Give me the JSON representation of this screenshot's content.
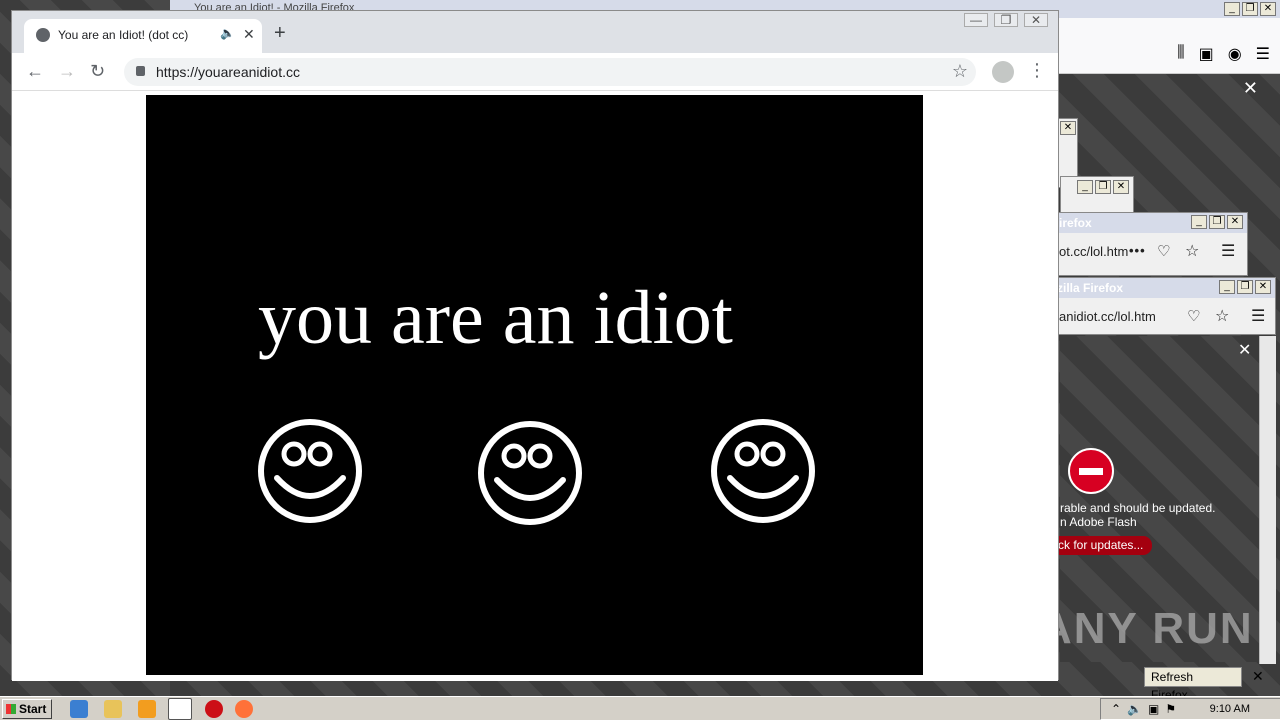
{
  "background_firefox": {
    "title_fragment": "You are an Idiot! - Mozilla Firefox",
    "popup1": {
      "title": "irefox",
      "url": "ot.cc/lol.htm"
    },
    "popup2": {
      "title": "zilla Firefox",
      "url": "anidiot.cc/lol.htm"
    },
    "flash_message_line1": "rable and should be updated.",
    "flash_message_line2": "n Adobe Flash",
    "flash_button": "ck for updates...",
    "refresh_button": "Refresh Firefox..."
  },
  "watermark": "ANY RUN",
  "chrome": {
    "tab_title": "You are an Idiot! (dot cc)",
    "new_tab_glyph": "+",
    "url": "https://youareanidiot.cc",
    "window_buttons": {
      "minimize": "—",
      "restore": "❐",
      "close": "✕"
    }
  },
  "page": {
    "headline": "you are an idiot",
    "smiley_count": 3
  },
  "taskbar": {
    "start_label": "Start",
    "clock": "9:10 AM"
  },
  "colors": {
    "chrome_tabstrip": "#dee1e6",
    "page_stage": "#000000",
    "flash_blocked": "#d70022"
  }
}
